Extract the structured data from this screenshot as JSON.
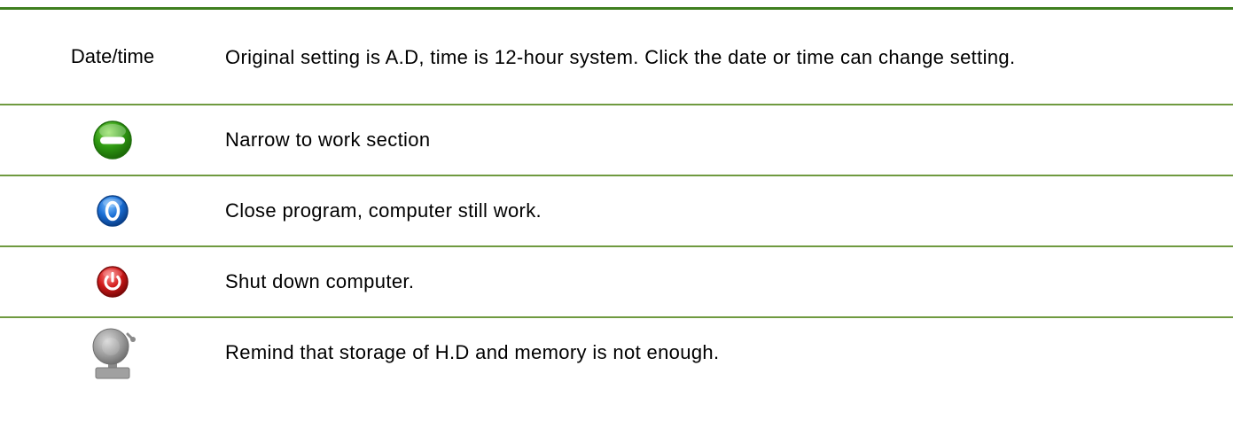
{
  "rows": [
    {
      "label": "Date/time",
      "icon": null,
      "description": "Original setting is A.D, time is 12-hour system. Click the date or time can change setting."
    },
    {
      "label": "",
      "icon": "minimize-icon",
      "description": "Narrow to work section"
    },
    {
      "label": "",
      "icon": "close-program-icon",
      "description": "Close program, computer still work."
    },
    {
      "label": "",
      "icon": "power-off-icon",
      "description": "Shut down computer."
    },
    {
      "label": "",
      "icon": "alarm-bell-icon",
      "description": "Remind that storage of H.D and memory is not enough."
    }
  ],
  "colors": {
    "rule_top": "#3f7f1f",
    "rule_rows": "#6f9a3f",
    "minimize_green": "#2f9a12",
    "close_blue": "#1a6fd6",
    "power_red": "#d11a1a",
    "bell_gray": "#9a9a9a"
  }
}
